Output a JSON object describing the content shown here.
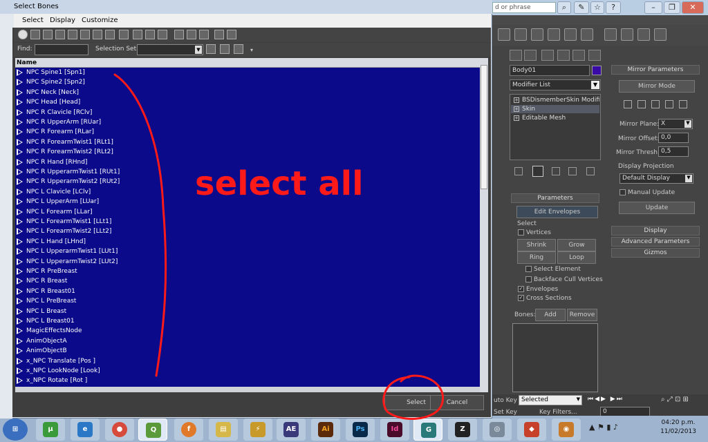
{
  "dialog": {
    "title": "Select Bones",
    "menu": [
      "Select",
      "Display",
      "Customize"
    ],
    "find_label": "Find:",
    "find_value": "",
    "selection_set_label": "Selection Set:",
    "selection_set_value": "",
    "column_header": "Name",
    "bones": [
      "NPC Spine1 [Spn1]",
      "NPC Spine2 [Spn2]",
      "NPC Neck [Neck]",
      "NPC Head [Head]",
      "NPC R Clavicle [RClv]",
      "NPC R UpperArm [RUar]",
      "NPC R Forearm [RLar]",
      "NPC R ForearmTwist1 [RLt1]",
      "NPC R ForearmTwist2 [RLt2]",
      "NPC R Hand [RHnd]",
      "NPC R UpperarmTwist1 [RUt1]",
      "NPC R UpperarmTwist2 [RUt2]",
      "NPC L Clavicle [LClv]",
      "NPC L UpperArm [LUar]",
      "NPC L Forearm [LLar]",
      "NPC L ForearmTwist1 [LLt1]",
      "NPC L ForearmTwist2 [LLt2]",
      "NPC L Hand [LHnd]",
      "NPC L UpperarmTwist1 [LUt1]",
      "NPC L UpperarmTwist2 [LUt2]",
      "NPC R PreBreast",
      "NPC R Breast",
      "NPC R Breast01",
      "NPC L PreBreast",
      "NPC L Breast",
      "NPC L Breast01",
      "MagicEffectsNode",
      "AnimObjectA",
      "AnimObjectB",
      "x_NPC Translate [Pos ]",
      "x_NPC LookNode [Look]",
      "x_NPC Rotate [Rot ]"
    ],
    "select_button": "Select",
    "cancel_button": "Cancel"
  },
  "annotation": {
    "text": "select all",
    "color": "#ff1a1a"
  },
  "app": {
    "search_placeholder": "d or phrase",
    "object_name": "Body01",
    "object_color": "#3a0aa6",
    "modifier_list_label": "Modifier List",
    "stack": [
      "BSDismemberSkin Modifier",
      "Skin",
      "Editable Mesh"
    ],
    "mirror": {
      "header": "Mirror Parameters",
      "mode_button": "Mirror Mode",
      "plane_label": "Mirror Plane:",
      "plane_value": "X",
      "offset_label": "Mirror Offset:",
      "offset_value": "0,0",
      "thresh_label": "Mirror Thresh.:",
      "thresh_value": "0,5",
      "projection_label": "Display Projection",
      "projection_value": "Default Display",
      "manual_update_label": "Manual Update",
      "update_button": "Update"
    },
    "rollouts": [
      "Display",
      "Advanced Parameters",
      "Gizmos"
    ],
    "params": {
      "header": "Parameters",
      "edit_envelopes": "Edit Envelopes",
      "select_group": "Select",
      "vertices": "Vertices",
      "shrink": "Shrink",
      "grow": "Grow",
      "ring": "Ring",
      "loop": "Loop",
      "select_element": "Select Element",
      "backface": "Backface Cull Vertices",
      "envelopes": "Envelopes",
      "cross_sections": "Cross Sections",
      "bones_label": "Bones:",
      "add": "Add",
      "remove": "Remove"
    },
    "bottom": {
      "auto_key": "uto Key",
      "selected": "Selected",
      "set_key": "Set Key",
      "key_filters": "Key Filters...",
      "frame": "0"
    }
  },
  "taskbar": {
    "time": "04:20 p.m.",
    "date": "11/02/2013",
    "apps": [
      "uTorrent",
      "Internet Explorer",
      "Chrome",
      "Quantum GIS",
      "Firefox",
      "Explorer",
      "Winamp",
      "After Effects",
      "Illustrator",
      "Photoshop",
      "InDesign",
      "3ds Max",
      "ZBrush",
      "Media Player",
      "Game",
      "Game2"
    ]
  }
}
